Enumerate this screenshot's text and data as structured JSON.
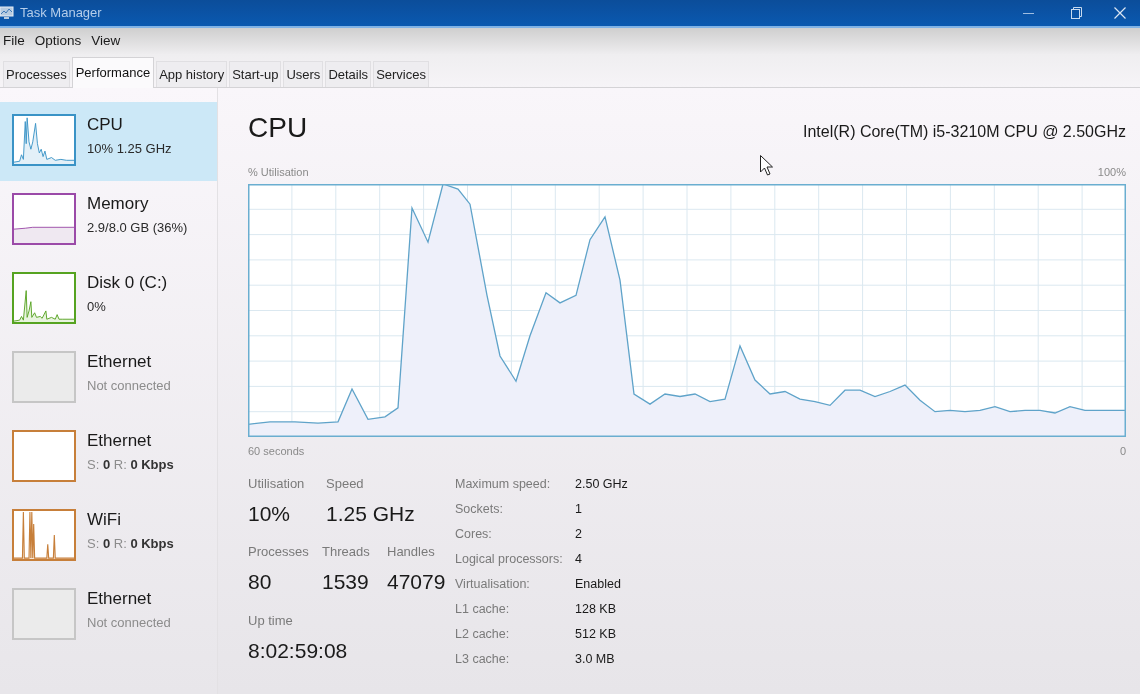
{
  "window": {
    "title": "Task Manager"
  },
  "menu": [
    "File",
    "Options",
    "View"
  ],
  "tabs": [
    {
      "label": "Processes",
      "selected": false
    },
    {
      "label": "Performance",
      "selected": true
    },
    {
      "label": "App history",
      "selected": false
    },
    {
      "label": "Start-up",
      "selected": false
    },
    {
      "label": "Users",
      "selected": false
    },
    {
      "label": "Details",
      "selected": false
    },
    {
      "label": "Services",
      "selected": false
    }
  ],
  "sidebar": {
    "items": [
      {
        "name": "CPU",
        "detail": "10% 1.25 GHz",
        "selected": true,
        "kind": "cpu",
        "color": "#3a93c6"
      },
      {
        "name": "Memory",
        "detail": "2.9/8.0 GB (36%)",
        "selected": false,
        "kind": "memory",
        "color": "#9b4aa8"
      },
      {
        "name": "Disk 0 (C:)",
        "detail": "0%",
        "selected": false,
        "kind": "disk",
        "color": "#56a321"
      },
      {
        "name": "Ethernet",
        "detail": "Not connected",
        "selected": false,
        "kind": "disconnected",
        "color": "#c6c6c6"
      },
      {
        "name": "Ethernet",
        "detail": "S: **0** R: **0 Kbps**",
        "selected": false,
        "kind": "idle",
        "color": "#c77f3a"
      },
      {
        "name": "WiFi",
        "detail": "S: **0** R: **0 Kbps**",
        "selected": false,
        "kind": "network",
        "color": "#c77f3a"
      },
      {
        "name": "Ethernet",
        "detail": "Not connected",
        "selected": false,
        "kind": "disconnected",
        "color": "#c6c6c6"
      }
    ]
  },
  "main": {
    "title": "CPU",
    "processor": "Intel(R) Core(TM) i5-3210M CPU @ 2.50GHz",
    "graph": {
      "title": "% Utilisation",
      "max_label": "100%",
      "start_label": "60 seconds",
      "end_label": "0"
    }
  },
  "stats": {
    "rows": [
      [
        {
          "label": "Utilisation",
          "value": "10%"
        },
        {
          "label": "Speed",
          "value": "1.25 GHz"
        }
      ],
      [
        {
          "label": "Processes",
          "value": "80"
        },
        {
          "label": "Threads",
          "value": "1539"
        },
        {
          "label": "Handles",
          "value": "47079"
        }
      ],
      [
        {
          "label": "Up time",
          "value": "8:02:59:08"
        }
      ]
    ],
    "details": [
      {
        "label": "Maximum speed:",
        "value": "2.50 GHz"
      },
      {
        "label": "Sockets:",
        "value": "1"
      },
      {
        "label": "Cores:",
        "value": "2"
      },
      {
        "label": "Logical processors:",
        "value": "4"
      },
      {
        "label": "Virtualisation:",
        "value": "Enabled"
      },
      {
        "label": "L1 cache:",
        "value": "128 KB"
      },
      {
        "label": "L2 cache:",
        "value": "512 KB"
      },
      {
        "label": "L3 cache:",
        "value": "3.0 MB"
      }
    ]
  }
}
